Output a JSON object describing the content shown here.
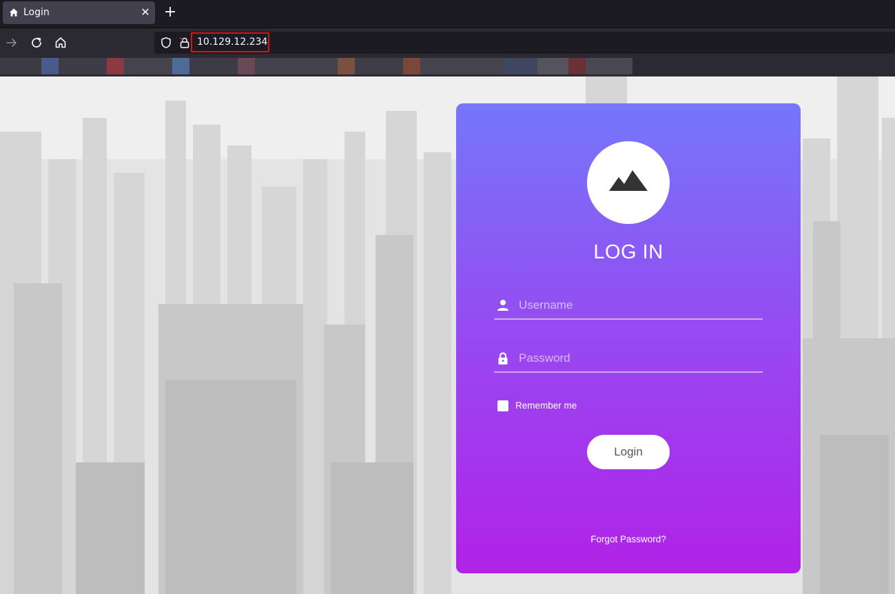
{
  "browser": {
    "tab": {
      "title": "Login",
      "icon": "home-icon"
    },
    "url": "10.129.12.234",
    "colors": {
      "url_highlight": "#e01010"
    }
  },
  "page": {
    "title": "LOG IN",
    "logo_icon": "mountain-icon",
    "username": {
      "placeholder": "Username",
      "icon": "user-icon"
    },
    "password": {
      "placeholder": "Password",
      "icon": "lock-icon"
    },
    "remember_label": "Remember me",
    "login_label": "Login",
    "forgot_label": "Forgot Password?",
    "colors": {
      "gradient_top": "#7577fb",
      "gradient_bottom": "#b122e8"
    }
  }
}
